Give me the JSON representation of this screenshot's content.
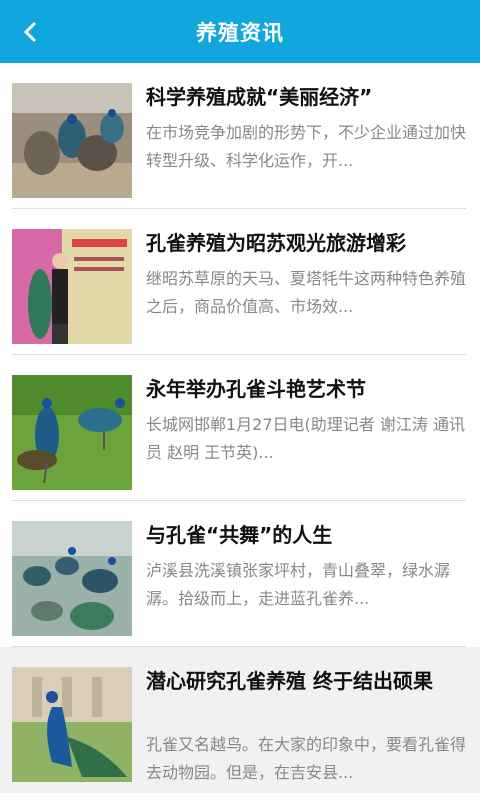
{
  "header": {
    "title": "养殖资讯",
    "back_icon": "back-arrow-icon",
    "background": "#11a7dd"
  },
  "articles": [
    {
      "title": "科学养殖成就“美丽经济”",
      "summary": "在市场竞争加剧的形势下，不少企业通过加快转型升级、科学化运作，开..."
    },
    {
      "title": "孔雀养殖为昭苏观光旅游增彩",
      "summary": "继昭苏草原的天马、夏塔牦牛这两种特色养殖之后，商品价值高、市场效..."
    },
    {
      "title": "永年举办孔雀斗艳艺术节",
      "summary": "长城网邯郸1月27日电(助理记者 谢江涛 通讯员 赵明 王节英)..."
    },
    {
      "title": "与孔雀“共舞”的人生",
      "summary": "泸溪县洗溪镇张家坪村，青山叠翠，绿水潺潺。拾级而上，走进蓝孔雀养..."
    },
    {
      "title": "潜心研究孔雀养殖 终于结出硕果",
      "summary": "孔雀又名越鸟。在大家的印象中，要看孔雀得去动物园。但是，在吉安县..."
    }
  ]
}
